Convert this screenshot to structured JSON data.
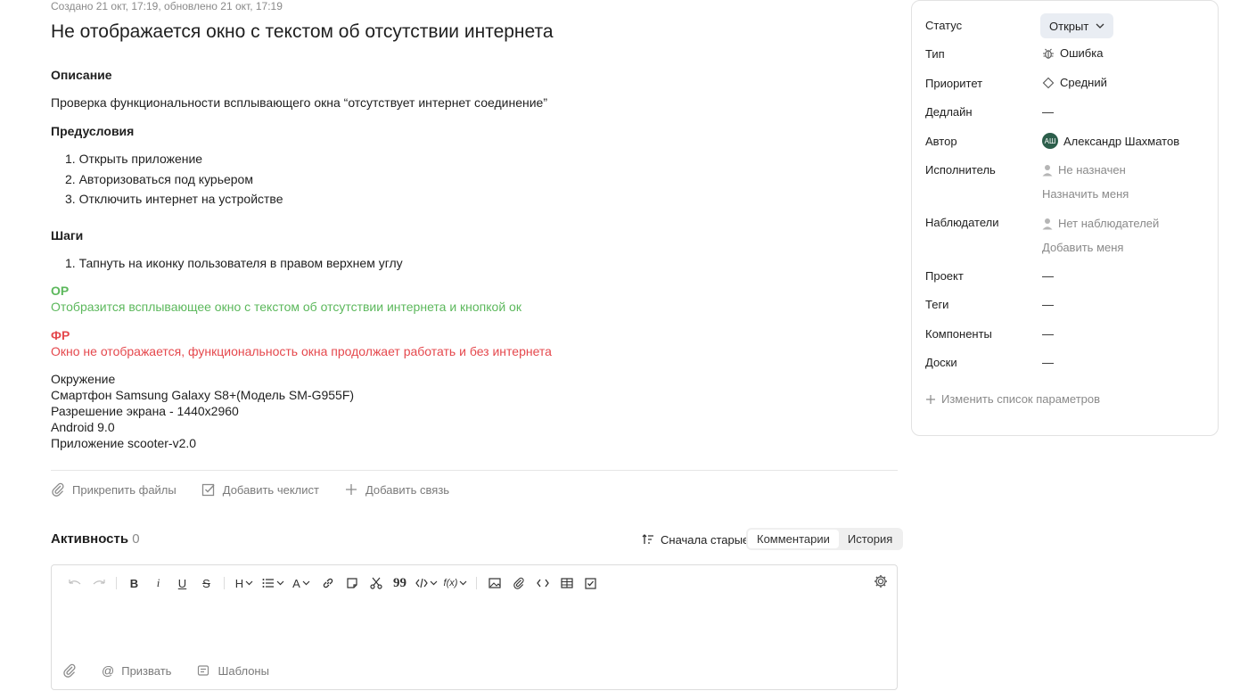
{
  "issue": {
    "meta": "Создано 21 окт, 17:19, обновлено 21 окт, 17:19",
    "title": "Не отображается окно с текстом об отсутствии интернета",
    "description_heading": "Описание",
    "description": "Проверка функциональности всплывающего окна “отсутствует интернет соединение”",
    "preconditions_heading": "Предусловия",
    "preconditions": [
      "1. Открыть приложение",
      "2. Авторизоваться под курьером",
      "3. Отключить интернет на устройстве"
    ],
    "steps_heading": "Шаги",
    "steps": [
      "1. Тапнуть на иконку пользователя в правом верхнем углу"
    ],
    "expected_heading": "ОР",
    "expected": "Отобразится всплывающее окно с текстом об отсутствии интернета и кнопкой ок",
    "actual_heading": "ФР",
    "actual": "Окно не отображается, функциональность окна продолжает работать и без интернета",
    "environment": [
      "Окружение",
      "Смартфон Samsung Galaxy S8+(Модель SM-G955F)",
      "Разрешение экрана - 1440x2960",
      "Android 9.0",
      "Приложение scooter-v2.0"
    ]
  },
  "actions": {
    "attach": "Прикрепить файлы",
    "checklist": "Добавить чеклист",
    "link": "Добавить связь"
  },
  "activity": {
    "title": "Активность",
    "count": "0",
    "sort": "Сначала старые",
    "tabs": [
      "Комментарии",
      "История"
    ]
  },
  "editor": {
    "mention": "Призвать",
    "templates": "Шаблоны"
  },
  "sidebar": {
    "status_label": "Статус",
    "status_value": "Открыт",
    "type_label": "Тип",
    "type_value": "Ошибка",
    "priority_label": "Приоритет",
    "priority_value": "Средний",
    "deadline_label": "Дедлайн",
    "deadline_value": "—",
    "author_label": "Автор",
    "author_initials": "АШ",
    "author_value": "Александр Шахматов",
    "assignee_label": "Исполнитель",
    "assignee_value": "Не назначен",
    "assign_me": "Назначить меня",
    "watchers_label": "Наблюдатели",
    "watchers_value": "Нет наблюдателей",
    "add_me": "Добавить меня",
    "project_label": "Проект",
    "project_value": "—",
    "tags_label": "Теги",
    "tags_value": "—",
    "components_label": "Компоненты",
    "components_value": "—",
    "boards_label": "Доски",
    "boards_value": "—",
    "edit_params": "Изменить список параметров"
  },
  "colors": {
    "expected": "#5cb85c",
    "actual": "#e5484d",
    "avatar": "#2c5e4b"
  }
}
